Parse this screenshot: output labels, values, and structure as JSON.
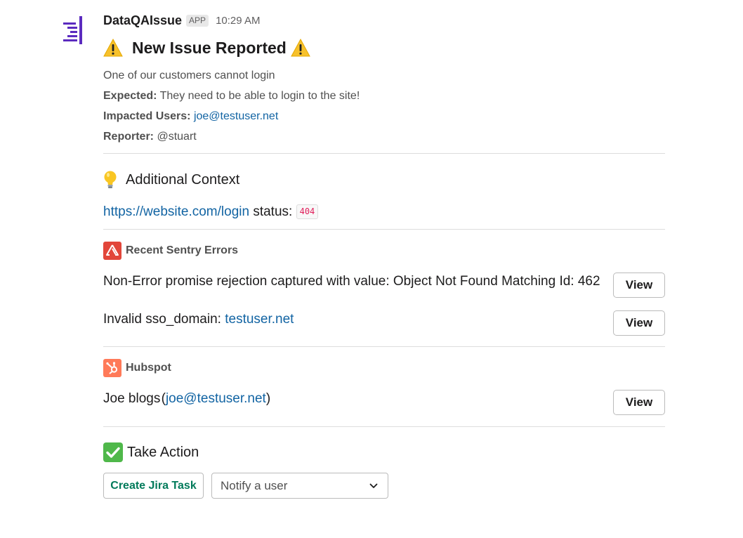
{
  "message": {
    "sender": "DataQAIssue",
    "badge": "APP",
    "time": "10:29 AM",
    "title": "New Issue Reported",
    "description": "One of our customers cannot login",
    "expected_label": "Expected:",
    "expected_value": "They need to be able to login to the site!",
    "impacted_label": "Impacted Users:",
    "impacted_value": "joe@testuser.net",
    "reporter_label": "Reporter:",
    "reporter_value": "@stuart"
  },
  "context": {
    "heading": "Additional Context",
    "url": "https://website.com/login",
    "status_label": "status:",
    "status_code": "404"
  },
  "sentry": {
    "heading": "Recent Sentry Errors",
    "errors": [
      {
        "text": "Non-Error promise rejection captured with value: Object Not Found Matching Id: 462",
        "link": "",
        "button": "View"
      },
      {
        "text": "Invalid sso_domain:",
        "link": "testuser.net",
        "button": "View"
      }
    ]
  },
  "hubspot": {
    "heading": "Hubspot",
    "contact_name": "Joe blogs",
    "contact_email": "joe@testuser.net",
    "button": "View"
  },
  "actions": {
    "heading": "Take Action",
    "jira_button": "Create Jira Task",
    "notify_placeholder": "Notify a user"
  },
  "colors": {
    "link": "#1264a3",
    "primary_green": "#007a5a",
    "sentry_red": "#e2463a",
    "hubspot_orange": "#ff7a59",
    "avatar_purple": "#5b2bbf"
  }
}
